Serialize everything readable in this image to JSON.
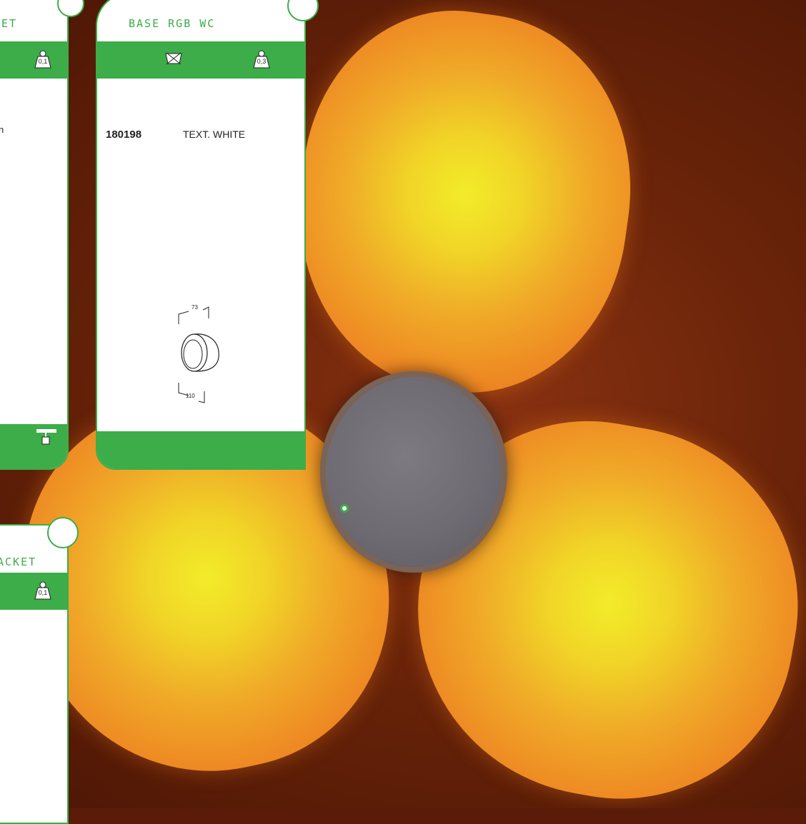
{
  "cards": {
    "left_top": {
      "title": "ET",
      "weight": "0,1",
      "line_fragment": "n"
    },
    "main": {
      "title": "BASE RGB WC",
      "weight": "0,3",
      "code": "180198",
      "description": "TEXT. WHITE",
      "dimension_top": "73",
      "dimension_bottom": "110"
    },
    "left_bottom": {
      "title": "ACKET",
      "weight": "0,1"
    }
  },
  "colors": {
    "accent_green": "#3cad48",
    "background_brown": "#5a1c08",
    "petal_yellow": "#f3ec2a",
    "petal_orange": "#ee8a23",
    "hub_grey": "#6f6b72"
  },
  "icons": {
    "no_wash": "no-wash-icon",
    "weight": "weight-icon",
    "mounting": "ceiling-mount-icon"
  }
}
